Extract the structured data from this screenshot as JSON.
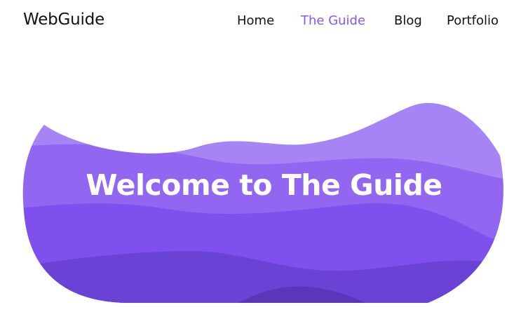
{
  "header": {
    "logo": "WebGuide",
    "nav": [
      {
        "label": "Home",
        "active": false
      },
      {
        "label": "The Guide",
        "active": true
      },
      {
        "label": "Blog",
        "active": false
      },
      {
        "label": "Portfolio",
        "active": false
      }
    ]
  },
  "hero": {
    "title": "Welcome to The Guide"
  },
  "colors": {
    "accent": "#8757f0",
    "wave_light": "#a684f5",
    "wave_mid": "#9166f1",
    "wave_base": "#7f50ed",
    "wave_dark": "#6b42d6",
    "wave_darkest": "#5a36b8",
    "text": "#111111"
  }
}
